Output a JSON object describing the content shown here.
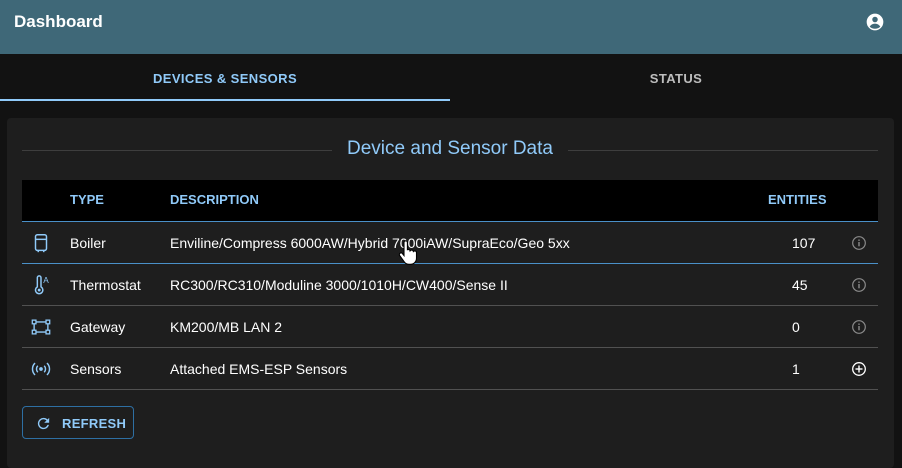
{
  "appbar": {
    "title": "Dashboard",
    "account_icon": "account-circle-icon"
  },
  "tabs": [
    {
      "label": "DEVICES & SENSORS",
      "selected": true
    },
    {
      "label": "STATUS",
      "selected": false
    }
  ],
  "section": {
    "title": "Device and Sensor Data"
  },
  "table": {
    "headers": {
      "type": "TYPE",
      "description": "DESCRIPTION",
      "entities": "ENTITIES"
    },
    "rows": [
      {
        "icon": "boiler-icon",
        "type": "Boiler",
        "description": "Enviline/Compress 6000AW/Hybrid 7000iAW/SupraEco/Geo 5xx",
        "entities": "107",
        "action_icon": "info-icon"
      },
      {
        "icon": "thermostat-icon",
        "type": "Thermostat",
        "description": "RC300/RC310/Moduline 3000/1010H/CW400/Sense II",
        "entities": "45",
        "action_icon": "info-icon"
      },
      {
        "icon": "gateway-icon",
        "type": "Gateway",
        "description": "KM200/MB LAN 2",
        "entities": "0",
        "action_icon": "info-icon"
      },
      {
        "icon": "sensors-icon",
        "type": "Sensors",
        "description": "Attached EMS-ESP Sensors",
        "entities": "1",
        "action_icon": "add-circle-icon"
      }
    ]
  },
  "refresh_button": {
    "label": "REFRESH",
    "icon": "refresh-icon"
  },
  "colors": {
    "appbar": "#3f6878",
    "accent": "#90caf9",
    "background": "#121212",
    "panel": "#1e1e1e",
    "header_row": "#000000"
  }
}
